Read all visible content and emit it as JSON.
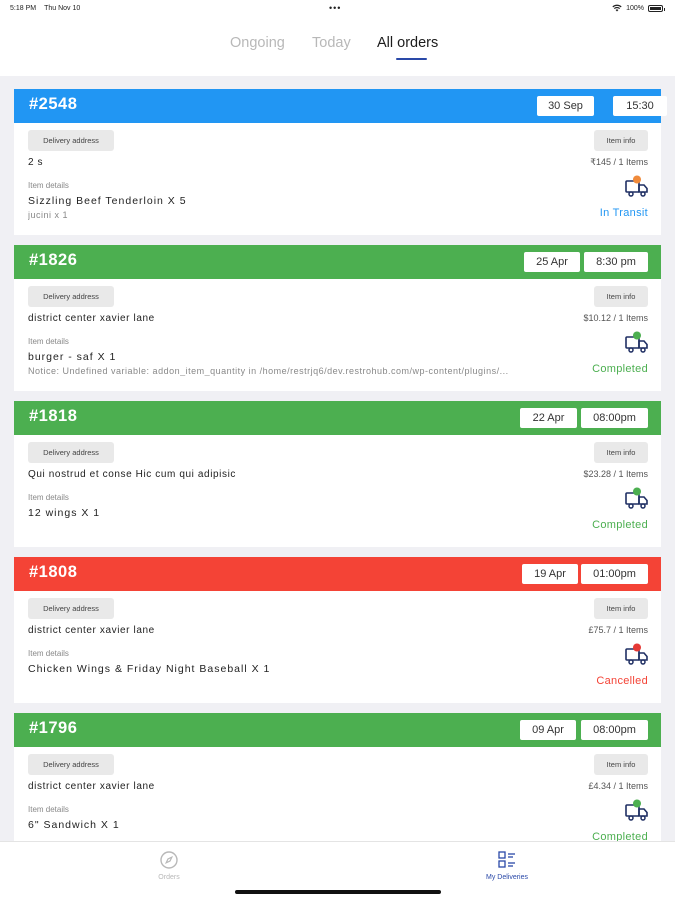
{
  "status_bar": {
    "time": "5:18 PM",
    "date": "Thu Nov 10",
    "battery": "100%"
  },
  "tabs": [
    {
      "label": "Ongoing",
      "active": false
    },
    {
      "label": "Today",
      "active": false
    },
    {
      "label": "All orders",
      "active": true
    }
  ],
  "labels": {
    "delivery_address": "Delivery address",
    "item_info": "Item info",
    "item_details": "Item details"
  },
  "orders": [
    {
      "number": "#2548",
      "date": "30 Sep",
      "time": "15:30",
      "address": "2 s",
      "price": "₹145 / 1 Items",
      "item": "Sizzling Beef Tenderloin X 5",
      "sub": "jucini x 1",
      "status": "In Transit",
      "header_color": "#2196f3",
      "status_color": "#2196f3",
      "badge_color": "#f08a3a"
    },
    {
      "number": "#1826",
      "date": "25 Apr",
      "time": "8:30 pm",
      "address": "district center xavier lane",
      "price": "$10.12 / 1 Items",
      "item": "burger - saf X 1",
      "sub": "Notice: Undefined variable: addon_item_quantity in /home/restrjq6/dev.restrohub.com/wp-content/plugins/...",
      "status": "Completed",
      "header_color": "#4caf50",
      "status_color": "#4caf50",
      "badge_color": "#4caf50"
    },
    {
      "number": "#1818",
      "date": "22 Apr",
      "time": "08:00pm",
      "address": "Qui nostrud et conse Hic cum qui adipisic",
      "price": "$23.28 / 1 Items",
      "item": "12 wings X 1",
      "sub": "",
      "status": "Completed",
      "header_color": "#4caf50",
      "status_color": "#4caf50",
      "badge_color": "#4caf50"
    },
    {
      "number": "#1808",
      "date": "19 Apr",
      "time": "01:00pm",
      "address": "district center xavier lane",
      "price": "£75.7 / 1 Items",
      "item": "Chicken Wings & Friday Night Baseball X 1",
      "sub": "",
      "status": "Cancelled",
      "header_color": "#f44336",
      "status_color": "#f44336",
      "badge_color": "#e53935"
    },
    {
      "number": "#1796",
      "date": "09 Apr",
      "time": "08:00pm",
      "address": "district center xavier lane",
      "price": "£4.34 / 1 Items",
      "item": "6\" Sandwich X 1",
      "sub": "",
      "status": "Completed",
      "header_color": "#4caf50",
      "status_color": "#4caf50",
      "badge_color": "#4caf50"
    }
  ],
  "bottom_nav": [
    {
      "label": "Orders",
      "icon": "compass-icon",
      "active": false
    },
    {
      "label": "My Deliveries",
      "icon": "deliveries-grid-icon",
      "active": true
    }
  ],
  "colors": {
    "accent": "#2a49a8",
    "inactive": "#b8b8b8"
  }
}
